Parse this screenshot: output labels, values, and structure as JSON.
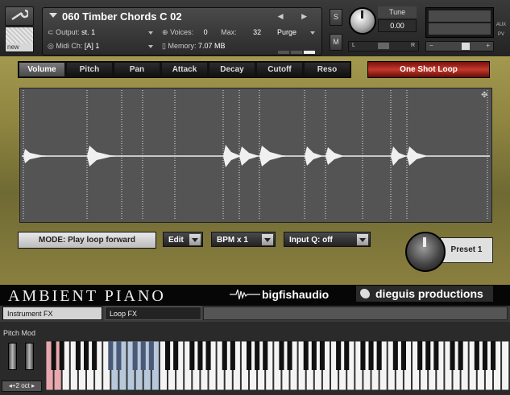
{
  "header": {
    "instrument_name": "060 Timber Chords C 02",
    "output_label": "Output:",
    "output_value": "st. 1",
    "voices_label": "Voices:",
    "voices_value": "0",
    "max_label": "Max:",
    "max_value": "32",
    "purge_label": "Purge",
    "midi_label": "Midi Ch:",
    "midi_value": "[A] 1",
    "memory_label": "Memory:",
    "memory_value": "7.07 MB",
    "new_label": "new",
    "nav_arrows": "◀ ▶",
    "solo_label": "S",
    "mute_label": "M",
    "tune_label": "Tune",
    "tune_value": "0.00",
    "pan_left": "L",
    "pan_right": "R",
    "vol_minus": "−",
    "vol_plus": "+",
    "aux_label": "AUX",
    "pv_label": "PV"
  },
  "param_tabs": [
    "Volume",
    "Pitch",
    "Pan",
    "Attack",
    "Decay",
    "Cutoff",
    "Reso"
  ],
  "active_tab": "Volume",
  "one_shot_label": "One Shot Loop",
  "controls": {
    "mode": "MODE: Play loop forward",
    "edit": "Edit",
    "bpm": "BPM x 1",
    "inputq": "Input Q: off",
    "preset": "Preset 1"
  },
  "brand": {
    "product": "AMBIENT PIANO",
    "vendor": "bigfishaudio",
    "producer": "dieguis productions"
  },
  "bottom_tabs": [
    "Instrument FX",
    "Loop FX"
  ],
  "keyboard": {
    "pitch_mod_label": "Pitch Mod",
    "octave_label": "◂+2 oct ▸"
  },
  "colors": {
    "panel_gold": "#8e8440",
    "one_shot_red": "#c23a2a",
    "waveform_bg": "#545454",
    "key_highlight_blue": "#b8c8dc",
    "key_highlight_red": "#e9a8ae"
  }
}
